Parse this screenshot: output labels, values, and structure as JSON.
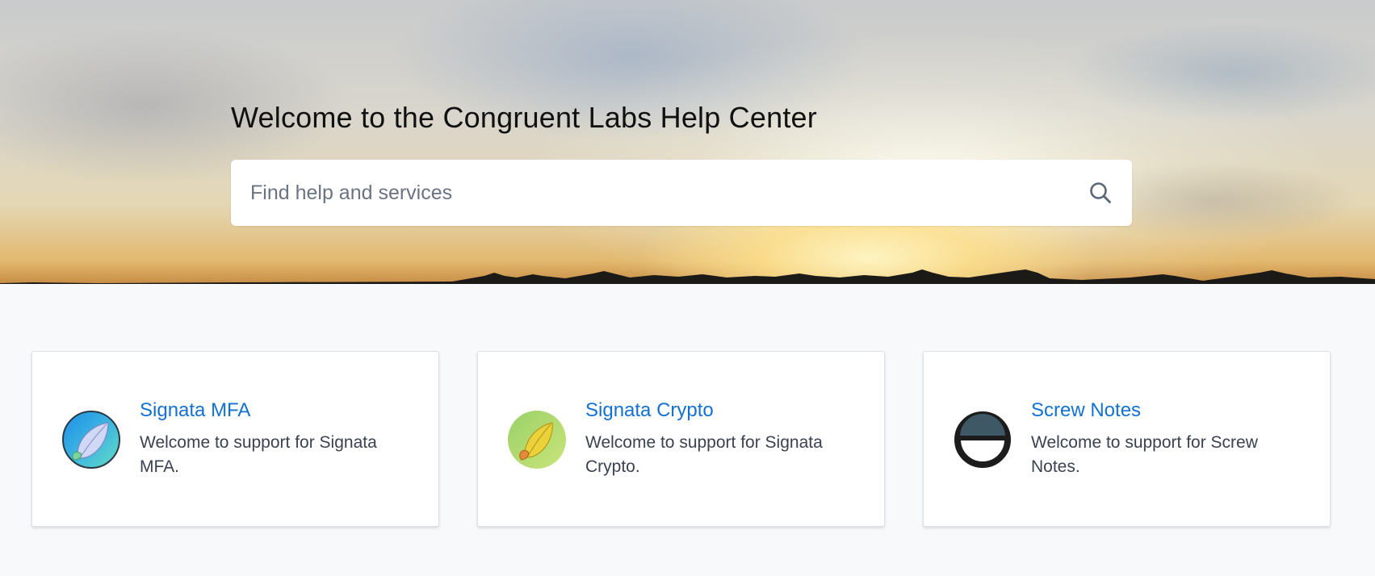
{
  "hero": {
    "title": "Welcome to the Congruent Labs Help Center"
  },
  "search": {
    "placeholder": "Find help and services",
    "value": "",
    "icon": "search-icon"
  },
  "products": [
    {
      "title": "Signata MFA",
      "description": "Welcome to support for Signata MFA.",
      "icon": "signata-mfa-logo"
    },
    {
      "title": "Signata Crypto",
      "description": "Welcome to support for Signata Crypto.",
      "icon": "signata-crypto-logo"
    },
    {
      "title": "Screw Notes",
      "description": "Welcome to support for Screw Notes.",
      "icon": "screw-notes-logo"
    }
  ],
  "colors": {
    "link": "#1271d1",
    "page_background": "#f8f9fb",
    "card_background": "#ffffff"
  }
}
